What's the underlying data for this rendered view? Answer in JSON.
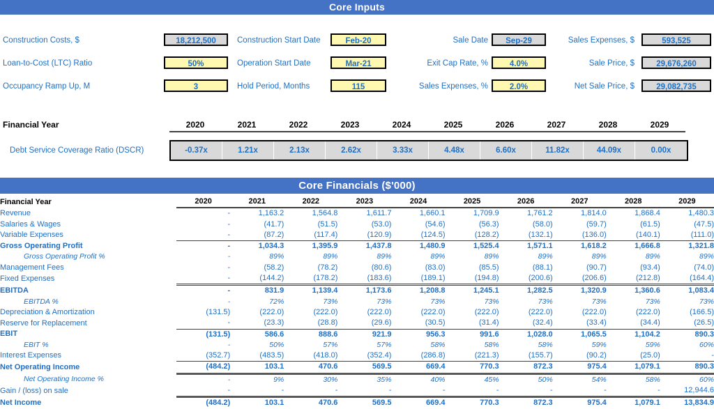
{
  "sections": {
    "core_inputs_title": "Core Inputs",
    "core_financials_title": "Core Financials ($'000)"
  },
  "core_inputs": {
    "rows": [
      {
        "c0_label": "Construction Costs, $",
        "c0_value": "18,212,500",
        "c0_style": "gray",
        "c1_label": "Construction Start Date",
        "c1_value": "Feb-20",
        "c1_style": "yellow",
        "c2_label": "Sale Date",
        "c2_value": "Sep-29",
        "c2_style": "gray",
        "c3_label": "Sales Expenses, $",
        "c3_value": "593,525",
        "c3_style": "gray"
      },
      {
        "c0_label": "Loan-to-Cost (LTC) Ratio",
        "c0_value": "50%",
        "c0_style": "yellow",
        "c1_label": "Operation Start Date",
        "c1_value": "Mar-21",
        "c1_style": "yellow",
        "c2_label": "Exit Cap Rate, %",
        "c2_value": "4.0%",
        "c2_style": "yellow",
        "c3_label": "Sale Price, $",
        "c3_value": "29,676,260",
        "c3_style": "gray"
      },
      {
        "c0_label": "Occupancy Ramp Up, M",
        "c0_value": "3",
        "c0_style": "yellow",
        "c1_label": "Hold Period, Months",
        "c1_value": "115",
        "c1_style": "yellow",
        "c2_label": "Sales Expenses, %",
        "c2_value": "2.0%",
        "c2_style": "yellow",
        "c3_label": "Net Sale Price, $",
        "c3_value": "29,082,735",
        "c3_style": "gray"
      }
    ]
  },
  "dscr": {
    "year_header_label": "Financial Year",
    "years": [
      "2020",
      "2021",
      "2022",
      "2023",
      "2024",
      "2025",
      "2026",
      "2027",
      "2028",
      "2029"
    ],
    "row_label": "Debt Service Coverage Ratio (DSCR)",
    "values": [
      "-0.37x",
      "1.21x",
      "2.13x",
      "2.62x",
      "3.33x",
      "4.48x",
      "6.60x",
      "11.82x",
      "44.09x",
      "0.00x"
    ]
  },
  "financials": {
    "header_label": "Financial Year",
    "years": [
      "2020",
      "2021",
      "2022",
      "2023",
      "2024",
      "2025",
      "2026",
      "2027",
      "2028",
      "2029"
    ],
    "rows": [
      {
        "label": "Revenue",
        "style": "plain",
        "values": [
          "-",
          "1,163.2",
          "1,564.8",
          "1,611.7",
          "1,660.1",
          "1,709.9",
          "1,761.2",
          "1,814.0",
          "1,868.4",
          "1,480.3"
        ]
      },
      {
        "label": "Salaries & Wages",
        "style": "plain",
        "values": [
          "-",
          "(41.7)",
          "(51.5)",
          "(53.0)",
          "(54.6)",
          "(56.3)",
          "(58.0)",
          "(59.7)",
          "(61.5)",
          "(47.5)"
        ]
      },
      {
        "label": "Variable Expenses",
        "style": "plain",
        "values": [
          "-",
          "(87.2)",
          "(117.4)",
          "(120.9)",
          "(124.5)",
          "(128.2)",
          "(132.1)",
          "(136.0)",
          "(140.1)",
          "(111.0)"
        ]
      },
      {
        "label": "Gross Operating Profit",
        "style": "bold rule-top",
        "values": [
          "-",
          "1,034.3",
          "1,395.9",
          "1,437.8",
          "1,480.9",
          "1,525.4",
          "1,571.1",
          "1,618.2",
          "1,666.8",
          "1,321.8"
        ]
      },
      {
        "label": "Gross Operating Profit %",
        "style": "pct",
        "values": [
          "-",
          "89%",
          "89%",
          "89%",
          "89%",
          "89%",
          "89%",
          "89%",
          "89%",
          "89%"
        ]
      },
      {
        "label": "Management Fees",
        "style": "plain",
        "values": [
          "-",
          "(58.2)",
          "(78.2)",
          "(80.6)",
          "(83.0)",
          "(85.5)",
          "(88.1)",
          "(90.7)",
          "(93.4)",
          "(74.0)"
        ]
      },
      {
        "label": "Fixed Expenses",
        "style": "plain",
        "values": [
          "-",
          "(144.2)",
          "(178.2)",
          "(183.6)",
          "(189.1)",
          "(194.8)",
          "(200.6)",
          "(206.6)",
          "(212.8)",
          "(164.4)"
        ]
      },
      {
        "label": "EBITDA",
        "style": "bold rule-dbl",
        "values": [
          "-",
          "831.9",
          "1,139.4",
          "1,173.6",
          "1,208.8",
          "1,245.1",
          "1,282.5",
          "1,320.9",
          "1,360.6",
          "1,083.4"
        ]
      },
      {
        "label": "EBITDA %",
        "style": "pct",
        "values": [
          "-",
          "72%",
          "73%",
          "73%",
          "73%",
          "73%",
          "73%",
          "73%",
          "73%",
          "73%"
        ]
      },
      {
        "label": "Depreciation & Amortization",
        "style": "plain",
        "values": [
          "(131.5)",
          "(222.0)",
          "(222.0)",
          "(222.0)",
          "(222.0)",
          "(222.0)",
          "(222.0)",
          "(222.0)",
          "(222.0)",
          "(166.5)"
        ]
      },
      {
        "label": "Reserve for Replacement",
        "style": "plain",
        "values": [
          "-",
          "(23.3)",
          "(28.8)",
          "(29.6)",
          "(30.5)",
          "(31.4)",
          "(32.4)",
          "(33.4)",
          "(34.4)",
          "(26.5)"
        ]
      },
      {
        "label": "EBIT",
        "style": "bold rule-top",
        "values": [
          "(131.5)",
          "586.6",
          "888.6",
          "921.9",
          "956.3",
          "991.6",
          "1,028.0",
          "1,065.5",
          "1,104.2",
          "890.3"
        ]
      },
      {
        "label": "EBIT %",
        "style": "pct",
        "values": [
          "-",
          "50%",
          "57%",
          "57%",
          "58%",
          "58%",
          "58%",
          "59%",
          "59%",
          "60%"
        ]
      },
      {
        "label": "Interest Expenses",
        "style": "plain",
        "values": [
          "(352.7)",
          "(483.5)",
          "(418.0)",
          "(352.4)",
          "(286.8)",
          "(221.3)",
          "(155.7)",
          "(90.2)",
          "(25.0)",
          "-"
        ]
      },
      {
        "label": "Net Operating Income",
        "style": "bold rule-top rule-thick-below",
        "values": [
          "(484.2)",
          "103.1",
          "470.6",
          "569.5",
          "669.4",
          "770.3",
          "872.3",
          "975.4",
          "1,079.1",
          "890.3"
        ]
      },
      {
        "label": "Net Operating Income %",
        "style": "pct",
        "values": [
          "-",
          "9%",
          "30%",
          "35%",
          "40%",
          "45%",
          "50%",
          "54%",
          "58%",
          "60%"
        ]
      },
      {
        "label": "Gain / (loss) on sale",
        "style": "plain",
        "values": [
          "-",
          "-",
          "-",
          "-",
          "-",
          "-",
          "-",
          "-",
          "-",
          "12,944.6"
        ]
      },
      {
        "label": "Net Income",
        "style": "bold rule-thick",
        "values": [
          "(484.2)",
          "103.1",
          "470.6",
          "569.5",
          "669.4",
          "770.3",
          "872.3",
          "975.4",
          "1,079.1",
          "13,834.9"
        ]
      }
    ]
  },
  "colors": {
    "banner_blue": "#4472C4",
    "text_blue": "#1F6FC4",
    "input_yellow": "#FFF8B0",
    "output_gray": "#D9D9D9",
    "rule_gray": "#595959"
  }
}
